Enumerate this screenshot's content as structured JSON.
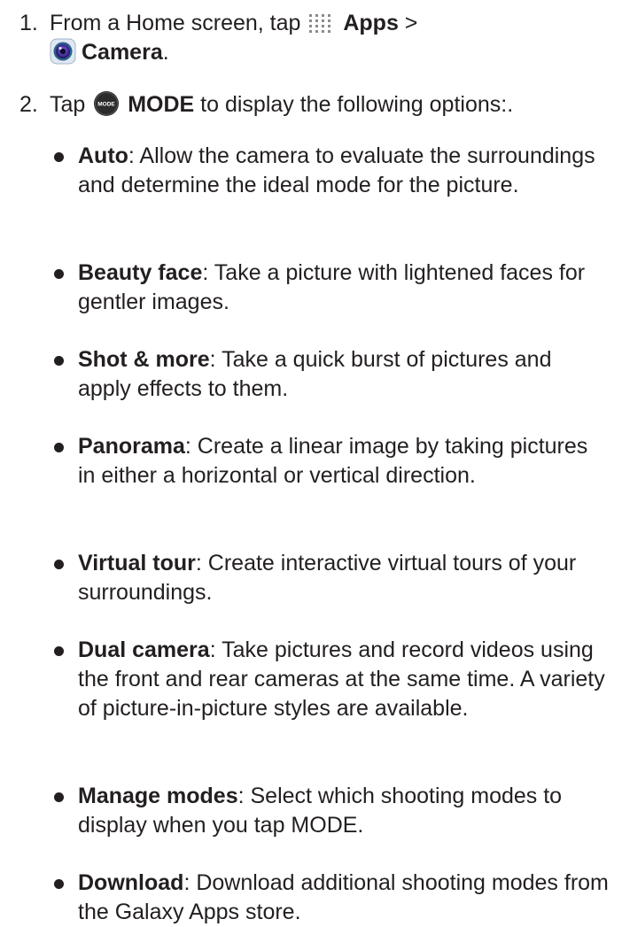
{
  "steps": [
    {
      "number": "1.",
      "pre": "From a Home screen, tap ",
      "apps_label": "Apps",
      "sep": " >",
      "camera_label": "Camera",
      "end": ".",
      "apps_icon": "apps-grid-icon",
      "camera_icon": "camera-lens-icon"
    },
    {
      "number": "2.",
      "pre": "Tap ",
      "mode_label": "MODE",
      "post": " to display the following options:.",
      "mode_icon": "mode-button-icon",
      "mode_icon_text": "MODE"
    }
  ],
  "options": [
    {
      "term": "Auto",
      "desc": ": Allow the camera to evaluate the surroundings and determine the ideal mode for the picture."
    },
    {
      "term": "Beauty face",
      "desc": ": Take a picture with lightened faces for gentler images."
    },
    {
      "term": "Shot & more",
      "desc": ": Take a quick burst of pictures and apply effects to them."
    },
    {
      "term": "Panorama",
      "desc": ": Create a linear image by taking pictures in either a horizontal or vertical direction."
    },
    {
      "term": "Virtual tour",
      "desc": ": Create interactive virtual tours of your surroundings."
    },
    {
      "term": "Dual camera",
      "desc": ": Take pictures and record videos using the front and rear cameras at the same time. A variety of picture-in-picture styles are available."
    },
    {
      "term": "Manage modes",
      "desc": ": Select which shooting modes to display when you tap MODE."
    },
    {
      "term": "Download",
      "desc": ": Download additional shooting modes from the Galaxy Apps store."
    }
  ]
}
